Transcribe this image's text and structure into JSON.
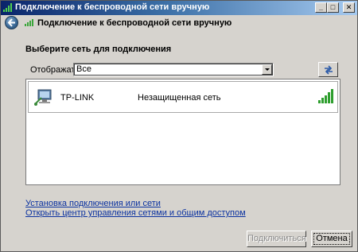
{
  "window": {
    "title": "Подключение к беспроводной сети вручную",
    "controls": {
      "minimize": "_",
      "maximize": "□",
      "close": "✕"
    }
  },
  "header": {
    "title": "Подключение к беспроводной сети вручную",
    "back_icon": "back-arrow-icon",
    "icon": "wireless-signal-icon"
  },
  "main": {
    "heading": "Выберите сеть для подключения",
    "filter": {
      "label": "Отображать",
      "value": "Все"
    },
    "refresh_icon": "refresh-icon",
    "networks": [
      {
        "name": "TP-LINK",
        "security": "Незащищенная сеть",
        "icon": "network-computer-icon",
        "signal_bars": 5,
        "signal_max": 5
      }
    ]
  },
  "links": {
    "setup": "Установка подключения или сети",
    "center": "Открыть центр управления сетями и общим доступом"
  },
  "buttons": {
    "connect": "Подключиться",
    "cancel": "Отмена"
  },
  "colors": {
    "link": "#0b32a0",
    "signal": "#2e9e2e",
    "titlebar": "#0a246a"
  }
}
